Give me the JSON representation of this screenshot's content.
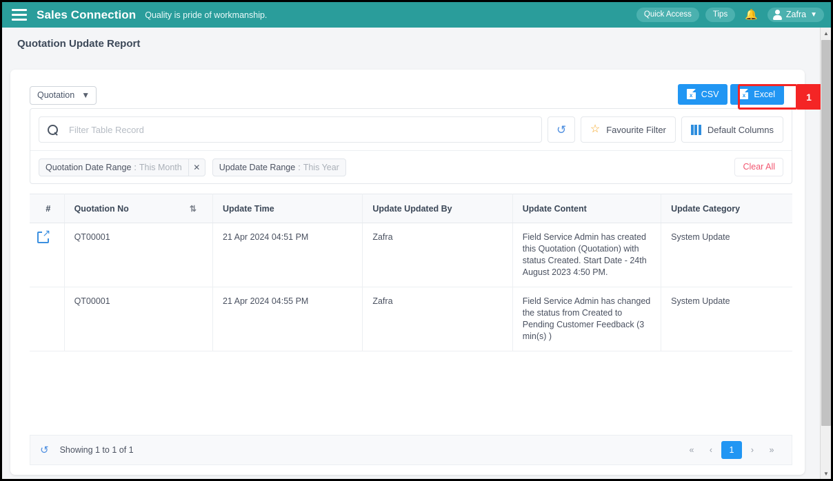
{
  "topbar": {
    "menu_icon": "hamburger-icon",
    "brand": "Sales Connection",
    "tagline": "Quality is pride of workmanship.",
    "quick_access": "Quick Access",
    "tips": "Tips",
    "bell_icon": "bell-icon",
    "user_name": "Zafra",
    "accent_color": "#2a9d9b"
  },
  "page": {
    "title": "Quotation Update Report"
  },
  "toolbar": {
    "module_select": "Quotation",
    "csv_label": "CSV",
    "excel_label": "Excel",
    "button_color": "#2196f3"
  },
  "annotation": {
    "number": "1",
    "color": "#f42525",
    "target": "excel-button"
  },
  "filter": {
    "search_placeholder": "Filter Table Record",
    "search_value": "",
    "refresh_icon": "refresh-icon",
    "favourite_filter": "Favourite Filter",
    "default_columns": "Default Columns",
    "clear_all": "Clear All",
    "chips": [
      {
        "label": "Quotation Date Range",
        "separator": ":",
        "value": "This Month",
        "removable": true
      },
      {
        "label": "Update Date Range",
        "separator": ":",
        "value": "This Year",
        "removable": false
      }
    ]
  },
  "table": {
    "columns": [
      {
        "key": "num",
        "label": "#",
        "sortable": false
      },
      {
        "key": "quotation_no",
        "label": "Quotation No",
        "sortable": true
      },
      {
        "key": "update_time",
        "label": "Update Time",
        "sortable": false
      },
      {
        "key": "update_updated_by",
        "label": "Update Updated By",
        "sortable": false
      },
      {
        "key": "update_content",
        "label": "Update Content",
        "sortable": false
      },
      {
        "key": "update_category",
        "label": "Update Category",
        "sortable": false
      }
    ],
    "rows": [
      {
        "has_open_icon": true,
        "quotation_no": "QT00001",
        "update_time": "21 Apr 2024 04:51 PM",
        "update_updated_by": "Zafra",
        "update_content": "Field Service Admin has created this Quotation (Quotation) with status Created. Start Date - 24th August 2023 4:50 PM.",
        "update_category": "System Update"
      },
      {
        "has_open_icon": false,
        "quotation_no": "QT00001",
        "update_time": "21 Apr 2024 04:55 PM",
        "update_updated_by": "Zafra",
        "update_content": "Field Service Admin has changed the status from Created to Pending Customer Feedback (3 min(s) )",
        "update_category": "System Update"
      }
    ]
  },
  "footer": {
    "refresh_icon": "refresh-icon",
    "showing": "Showing 1 to 1 of 1",
    "pagination": {
      "first": "«",
      "prev": "‹",
      "pages": [
        "1"
      ],
      "active_page": "1",
      "next": "›",
      "last": "»"
    }
  }
}
